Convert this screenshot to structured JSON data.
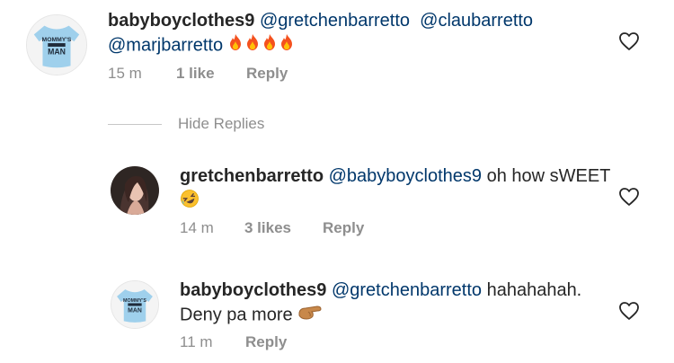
{
  "comments": [
    {
      "username": "babyboyclothes9",
      "mention1": "@gretchenbarretto",
      "mention2": "@claubarretto",
      "mention3": "@marjbarretto",
      "emoji": "fire-emoji x4",
      "time": "15 m",
      "likes": "1 like",
      "reply": "Reply"
    },
    {
      "username": "gretchenbarretto",
      "mention1": "@babyboyclothes9",
      "text": "oh how sWEET",
      "emoji": "rofl-emoji",
      "time": "14 m",
      "likes": "3 likes",
      "reply": "Reply"
    },
    {
      "username": "babyboyclothes9",
      "mention1": "@gretchenbarretto",
      "text": "hahahahah.",
      "text2": "Deny pa more",
      "emoji": "pointing-hand-emoji",
      "time": "11 m",
      "reply": "Reply"
    }
  ],
  "onesie_text": {
    "line1": "MOMMY'S",
    "line2": "MAN"
  },
  "hide_replies": "Hide Replies",
  "colors": {
    "mention": "#00376b",
    "meta": "#8e8e8e",
    "text": "#262626",
    "fire": "#f4511e"
  }
}
